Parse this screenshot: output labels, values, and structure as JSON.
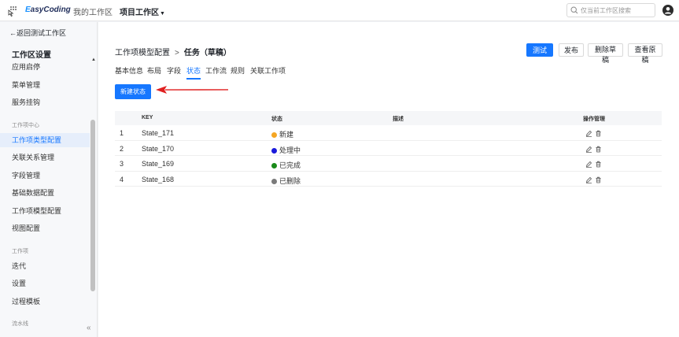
{
  "topbar": {
    "logo_initial": "E",
    "logo_rest": "asyCoding",
    "nav_my_workspace": "我的工作区",
    "nav_project_workspace": "项目工作区",
    "search_placeholder": "仅当前工作区搜索"
  },
  "sidebar": {
    "back_link": "←返回测试工作区",
    "title": "工作区设置",
    "items_top": [
      "应用启停",
      "菜单管理",
      "服务挂钩"
    ],
    "group_work_center": "工作项中心",
    "items_work_center": [
      "工作项类型配置",
      "关联关系管理",
      "字段管理",
      "基础数据配置",
      "工作项模型配置",
      "视图配置"
    ],
    "active_item": "工作项类型配置",
    "group_work_item": "工作项",
    "items_work_item": [
      "迭代",
      "设置",
      "过程模板"
    ],
    "group_pipeline": "流水线",
    "collapse_icon_label": "«"
  },
  "main": {
    "breadcrumb_parent": "工作项模型配置",
    "breadcrumb_sep": ">",
    "breadcrumb_current": "任务（草稿）",
    "buttons": {
      "test": "测试",
      "publish": "发布",
      "delete_draft": "删除草稿",
      "view_original": "查看原稿"
    },
    "tabs": [
      "基本信息",
      "布局",
      "字段",
      "状态",
      "工作流",
      "规则",
      "关联工作项"
    ],
    "active_tab": "状态",
    "new_status_button": "新建状态",
    "table": {
      "headers": {
        "key": "KEY",
        "status": "状态",
        "desc": "描述",
        "ops": "操作管理"
      },
      "rows": [
        {
          "index": "1",
          "key": "State_171",
          "status": "新建",
          "color": "#f5a623",
          "desc": ""
        },
        {
          "index": "2",
          "key": "State_170",
          "status": "处理中",
          "color": "#1a1adb",
          "desc": ""
        },
        {
          "index": "3",
          "key": "State_169",
          "status": "已完成",
          "color": "#1a8a1a",
          "desc": ""
        },
        {
          "index": "4",
          "key": "State_168",
          "status": "已删除",
          "color": "#7a7a7a",
          "desc": ""
        }
      ]
    }
  },
  "colors": {
    "accent": "#1677ff",
    "arrow": "#e02020"
  }
}
